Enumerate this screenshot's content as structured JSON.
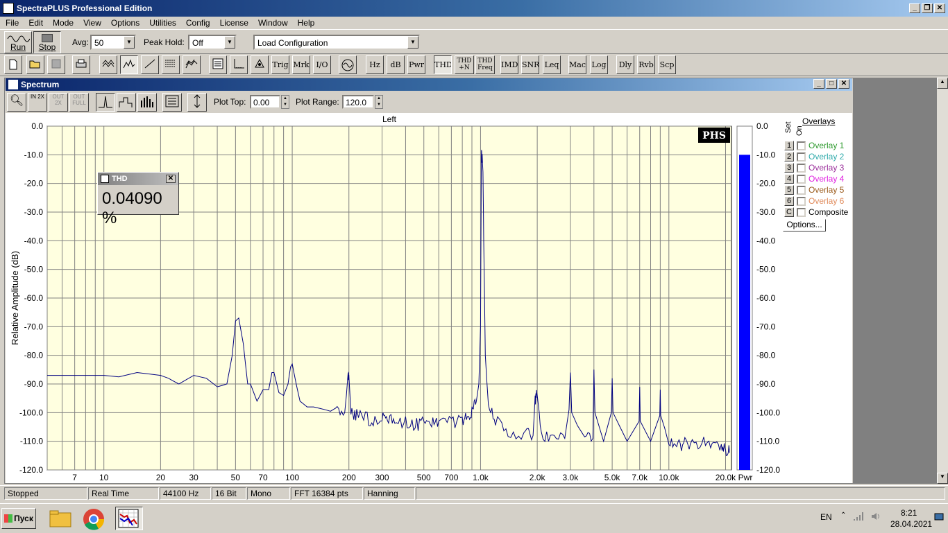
{
  "app": {
    "title": "SpectraPLUS Professional Edition"
  },
  "menu": [
    "File",
    "Edit",
    "Mode",
    "View",
    "Options",
    "Utilities",
    "Config",
    "License",
    "Window",
    "Help"
  ],
  "toolbar1": {
    "run_label": "Run",
    "stop_label": "Stop",
    "avg_label": "Avg:",
    "avg_value": "50",
    "peakhold_label": "Peak Hold:",
    "peakhold_value": "Off",
    "config_value": "Load Configuration"
  },
  "toolbar2": [
    {
      "label": "",
      "icon": "new-file-icon"
    },
    {
      "label": "",
      "icon": "open-folder-icon"
    },
    {
      "label": "",
      "icon": "save-disk-icon"
    },
    {
      "label": "",
      "icon": "print-icon"
    },
    {
      "label": "",
      "icon": "time-series-icon"
    },
    {
      "label": "",
      "icon": "spectrum-icon",
      "on": true
    },
    {
      "label": "",
      "icon": "phase-icon"
    },
    {
      "label": "",
      "icon": "spectrogram-icon"
    },
    {
      "label": "",
      "icon": "3d-surface-icon"
    },
    {
      "label": "",
      "icon": "settings-list-icon"
    },
    {
      "label": "",
      "icon": "axis-icon"
    },
    {
      "label": "",
      "icon": "calibrate-icon"
    },
    {
      "label": "Trig",
      "icon": "trigger"
    },
    {
      "label": "Mrk",
      "icon": "marker"
    },
    {
      "label": "I/O",
      "icon": "io"
    },
    {
      "label": "",
      "icon": "signal-generator-icon"
    },
    {
      "label": "Hz",
      "icon": "hz"
    },
    {
      "label": "dB",
      "icon": "db"
    },
    {
      "label": "Pwr",
      "icon": "pwr"
    },
    {
      "label": "THD",
      "icon": "thd",
      "on": true
    },
    {
      "label": "THD+N",
      "icon": "thdn"
    },
    {
      "label": "THD Freq",
      "icon": "thdfreq"
    },
    {
      "label": "IMD",
      "icon": "imd"
    },
    {
      "label": "SNR",
      "icon": "snr"
    },
    {
      "label": "Leq",
      "icon": "leq"
    },
    {
      "label": "Mac",
      "icon": "mac"
    },
    {
      "label": "Log",
      "icon": "log"
    },
    {
      "label": "Dly",
      "icon": "dly"
    },
    {
      "label": "Rvb",
      "icon": "rvb"
    },
    {
      "label": "Scp",
      "icon": "scp"
    }
  ],
  "spectrum_window": {
    "title": "Spectrum",
    "plot_top_label": "Plot Top:",
    "plot_top_value": "0.00",
    "plot_range_label": "Plot Range:",
    "plot_range_value": "120.0"
  },
  "thd_box": {
    "title": "THD",
    "value": "0.04090 %"
  },
  "overlays": {
    "title": "Overlays",
    "set_label": "Set",
    "on_label": "On",
    "items": [
      {
        "num": "1",
        "name": "Overlay 1",
        "color": "#2e9a2e"
      },
      {
        "num": "2",
        "name": "Overlay 2",
        "color": "#2eaaaa"
      },
      {
        "num": "3",
        "name": "Overlay 3",
        "color": "#9a2e9a"
      },
      {
        "num": "4",
        "name": "Overlay 4",
        "color": "#e020e0"
      },
      {
        "num": "5",
        "name": "Overlay 5",
        "color": "#9a5a1a"
      },
      {
        "num": "6",
        "name": "Overlay 6",
        "color": "#e08a5a"
      },
      {
        "num": "C",
        "name": "Composite",
        "color": "#000000"
      }
    ],
    "options_label": "Options..."
  },
  "chart_data": {
    "type": "line",
    "title": "Left",
    "ylabel": "Relative Amplitude (dB)",
    "xlabel": "",
    "xscale": "log",
    "xlim": [
      5,
      21500
    ],
    "ylim": [
      -120,
      0
    ],
    "yticks": [
      "0.0",
      "-10.0",
      "-20.0",
      "-30.0",
      "-40.0",
      "-50.0",
      "-60.0",
      "-70.0",
      "-80.0",
      "-90.0",
      "-100.0",
      "-110.0",
      "-120.0"
    ],
    "xticks": [
      {
        "v": 7,
        "l": "7"
      },
      {
        "v": 10,
        "l": "10"
      },
      {
        "v": 20,
        "l": "20"
      },
      {
        "v": 30,
        "l": "30"
      },
      {
        "v": 50,
        "l": "50"
      },
      {
        "v": 70,
        "l": "70"
      },
      {
        "v": 100,
        "l": "100"
      },
      {
        "v": 200,
        "l": "200"
      },
      {
        "v": 300,
        "l": "300"
      },
      {
        "v": 500,
        "l": "500"
      },
      {
        "v": 700,
        "l": "700"
      },
      {
        "v": 1000,
        "l": "1.0k"
      },
      {
        "v": 2000,
        "l": "2.0k"
      },
      {
        "v": 3000,
        "l": "3.0k"
      },
      {
        "v": 5000,
        "l": "5.0k"
      },
      {
        "v": 7000,
        "l": "7.0k"
      },
      {
        "v": 10000,
        "l": "10.0k"
      },
      {
        "v": 20000,
        "l": "20.0k"
      }
    ],
    "series": [
      {
        "color": "#000080",
        "x": [
          5,
          10,
          12,
          15,
          20,
          22,
          25,
          30,
          35,
          40,
          45,
          48,
          50,
          52,
          55,
          58,
          60,
          65,
          70,
          75,
          78,
          80,
          85,
          90,
          95,
          98,
          100,
          105,
          110,
          120,
          130,
          150,
          170,
          190,
          198,
          200,
          205,
          220,
          250,
          280,
          300,
          320,
          350,
          400,
          450,
          500,
          550,
          600,
          700,
          800,
          850,
          900,
          950,
          980,
          1000,
          1010,
          1020,
          1030,
          1040,
          1060,
          1100,
          1200,
          1400,
          1700,
          1900,
          1950,
          2000,
          2050,
          2100,
          2400,
          2800,
          2950,
          3000,
          3050,
          3500,
          3950,
          4000,
          4050,
          4500,
          4950,
          5000,
          5050,
          6000,
          6950,
          7000,
          7050,
          8000,
          8950,
          9000,
          9050,
          10000,
          11000,
          12000,
          13000,
          15000,
          17000,
          19000,
          20000,
          21000
        ],
        "y": [
          -87,
          -87,
          -87.5,
          -86,
          -87,
          -88,
          -90,
          -87,
          -88,
          -91,
          -90,
          -80,
          -68,
          -67,
          -76,
          -90,
          -90,
          -96,
          -92,
          -92,
          -86,
          -86,
          -93,
          -94,
          -90,
          -84,
          -83,
          -90,
          -96,
          -98,
          -98,
          -99,
          -100,
          -100,
          -88,
          -87,
          -100,
          -101,
          -102,
          -103,
          -101,
          -102,
          -103,
          -103,
          -104,
          -104,
          -104,
          -104,
          -103,
          -103,
          -102,
          -100,
          -96,
          -90,
          -70,
          -11,
          -10,
          -16,
          -40,
          -80,
          -98,
          -103,
          -106,
          -108,
          -108,
          -95,
          -94,
          -100,
          -109,
          -108,
          -109,
          -99,
          -86,
          -100,
          -109,
          -109,
          -85,
          -100,
          -110,
          -100,
          -88,
          -100,
          -110,
          -103,
          -91,
          -103,
          -110,
          -101,
          -92,
          -101,
          -110,
          -111,
          -111,
          -111,
          -111,
          -111,
          -112,
          -113,
          -114
        ]
      },
      {
        "name": "Pwr",
        "color": "#0000ff",
        "bar": true,
        "value": -10
      }
    ],
    "pwr_label": "Pwr",
    "logo": "PHS",
    "grid": true,
    "background": "#ffffe0"
  },
  "statusbar": [
    "Stopped",
    "Real Time",
    "44100 Hz",
    "16 Bit",
    "Mono",
    "FFT 16384 pts",
    "Hanning"
  ],
  "taskbar": {
    "start_label": "Пуск",
    "lang": "EN",
    "time": "8:21",
    "date": "28.04.2021"
  }
}
